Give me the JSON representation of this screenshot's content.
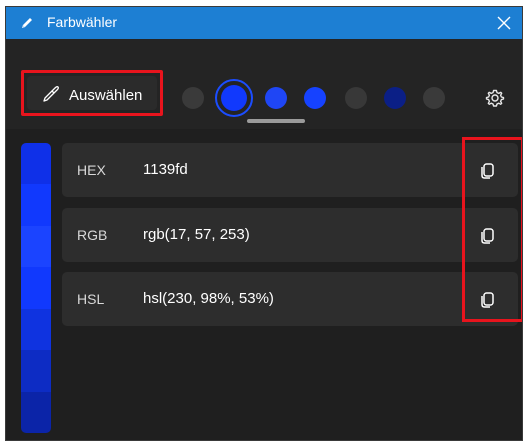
{
  "window": {
    "title": "Farbwähler"
  },
  "toolbar": {
    "pick_label": "Auswählen",
    "swatches": [
      "#3a3a3a",
      "#1139fd",
      "#1f46f5",
      "#1642ff",
      "#383838",
      "#3a3a3a",
      "#0b1f86",
      "#3a3a3a"
    ],
    "selected_swatch": "#1139fd"
  },
  "sidebar": {
    "shades": [
      "#0f30e8",
      "#1139fd",
      "#1b44ff",
      "#1139fd",
      "#0f33e0",
      "#0d2cc4",
      "#0b24a8"
    ]
  },
  "formats": [
    {
      "label": "HEX",
      "value": "1139fd"
    },
    {
      "label": "RGB",
      "value": "rgb(17, 57, 253)"
    },
    {
      "label": "HSL",
      "value": "hsl(230, 98%, 53%)"
    }
  ],
  "icons": {
    "app": "pencil-icon",
    "close": "close-icon",
    "pick": "eyedropper-icon",
    "settings": "gear-icon",
    "copy": "copy-icon"
  },
  "colors": {
    "titlebar": "#1d7fd3",
    "highlight": "#e8141d",
    "selected_color": "#1139fd"
  }
}
